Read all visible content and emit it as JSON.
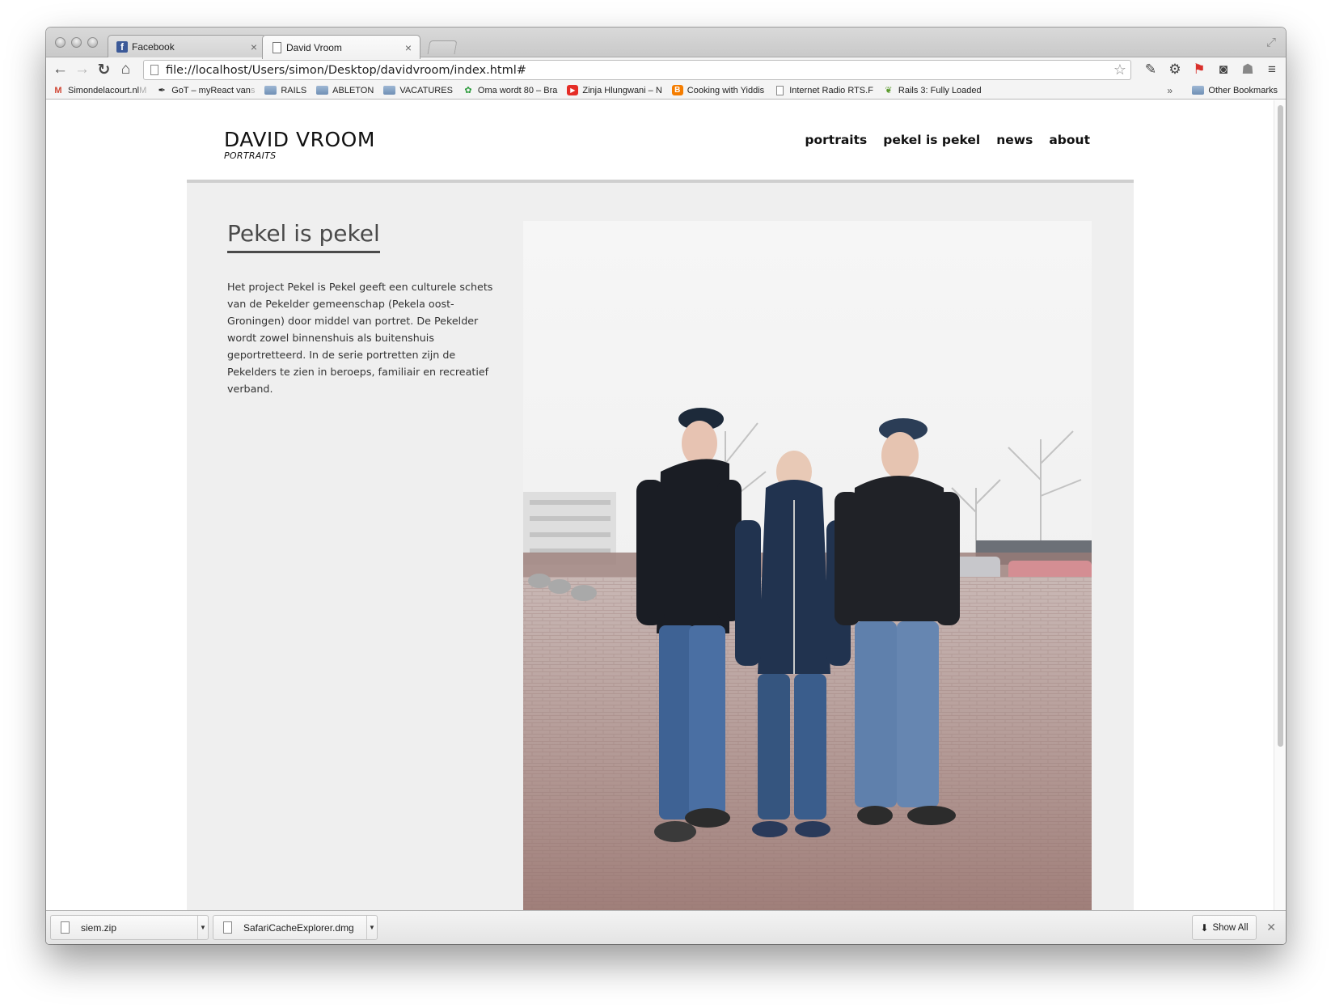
{
  "browser": {
    "tabs": [
      {
        "title": "Facebook",
        "icon": "facebook-icon",
        "active": false
      },
      {
        "title": "David Vroom",
        "icon": "document-icon",
        "active": true
      }
    ],
    "address": "file://localhost/Users/simon/Desktop/davidvroom/index.html#",
    "bookmarks": [
      {
        "label": "Simondelacourt.nl",
        "fade": " M",
        "icon": "gmail-icon"
      },
      {
        "label": "GoT – myReact van",
        "fade": " s",
        "icon": "feather-icon"
      },
      {
        "label": "RAILS",
        "fade": "",
        "icon": "folder-icon"
      },
      {
        "label": "ABLETON",
        "fade": "",
        "icon": "folder-icon"
      },
      {
        "label": "VACATURES",
        "fade": "",
        "icon": "folder-icon"
      },
      {
        "label": "Oma wordt 80 – Bra",
        "fade": "",
        "icon": "picasa-icon"
      },
      {
        "label": "Zinja Hlungwani – N",
        "fade": "",
        "icon": "youtube-icon"
      },
      {
        "label": "Cooking with Yiddis",
        "fade": "",
        "icon": "blogger-icon"
      },
      {
        "label": "Internet Radio RTS.F",
        "fade": "",
        "icon": "document-icon"
      },
      {
        "label": "Rails 3: Fully Loaded",
        "fade": "",
        "icon": "evernote-icon"
      }
    ],
    "bookmarks_more": "»",
    "other_bookmarks": "Other Bookmarks"
  },
  "site": {
    "logo_title": "DAVID VROOM",
    "logo_sub": "PORTRAITS",
    "nav": [
      "portraits",
      "pekel is pekel",
      "news",
      "about"
    ],
    "section_title": "Pekel is pekel",
    "section_body": "Het project Pekel is Pekel geeft een culturele schets van de Pekelder gemeenschap (Pekela oost-Groningen) door middel van portret. De Pekelder wordt zowel binnenshuis als buitenshuis geportretteerd. In de serie portretten zijn de Pekelders te zien in beroeps, familiair en recreatief verband."
  },
  "downloads": {
    "items": [
      "siem.zip",
      "SafariCacheExplorer.dmg"
    ],
    "show_all": "Show All"
  },
  "colors": {
    "page_bg": "#efefef",
    "header_bg": "#ffffff",
    "header_rule": "#cfcfcf",
    "title_color": "#4a4a4a"
  }
}
